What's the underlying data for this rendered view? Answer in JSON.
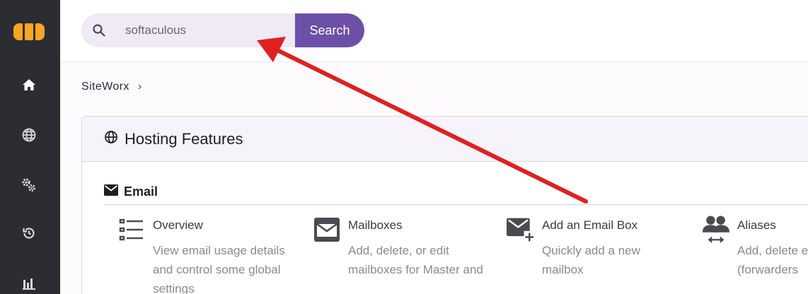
{
  "sidebar": {
    "items": [
      {
        "name": "home",
        "icon": "home-icon"
      },
      {
        "name": "domains",
        "icon": "globe-icon"
      },
      {
        "name": "settings",
        "icon": "gears-icon"
      },
      {
        "name": "backup",
        "icon": "history-icon"
      },
      {
        "name": "statistics",
        "icon": "bar-chart-icon"
      }
    ],
    "logo_color": "#f7a623"
  },
  "search": {
    "value": "softaculous",
    "button_label": "Search"
  },
  "breadcrumb": {
    "item": "SiteWorx",
    "separator": "›"
  },
  "card": {
    "title": "Hosting Features"
  },
  "email_section": {
    "title": "Email",
    "features": [
      {
        "title": "Overview",
        "description": "View email usage details and control some global settings",
        "icon": "list-icon"
      },
      {
        "title": "Mailboxes",
        "description": "Add, delete, or edit mailboxes for Master and",
        "icon": "envelope-icon"
      },
      {
        "title": "Add an Email Box",
        "description": "Quickly add a new mailbox",
        "icon": "envelope-plus-icon"
      },
      {
        "title": "Aliases",
        "description": "Add, delete email aliases (forwarders",
        "icon": "users-arrows-icon"
      }
    ]
  },
  "colors": {
    "accent": "#6d4fa8",
    "sidebar": "#2c2c33",
    "annotation_arrow": "#e02020"
  }
}
